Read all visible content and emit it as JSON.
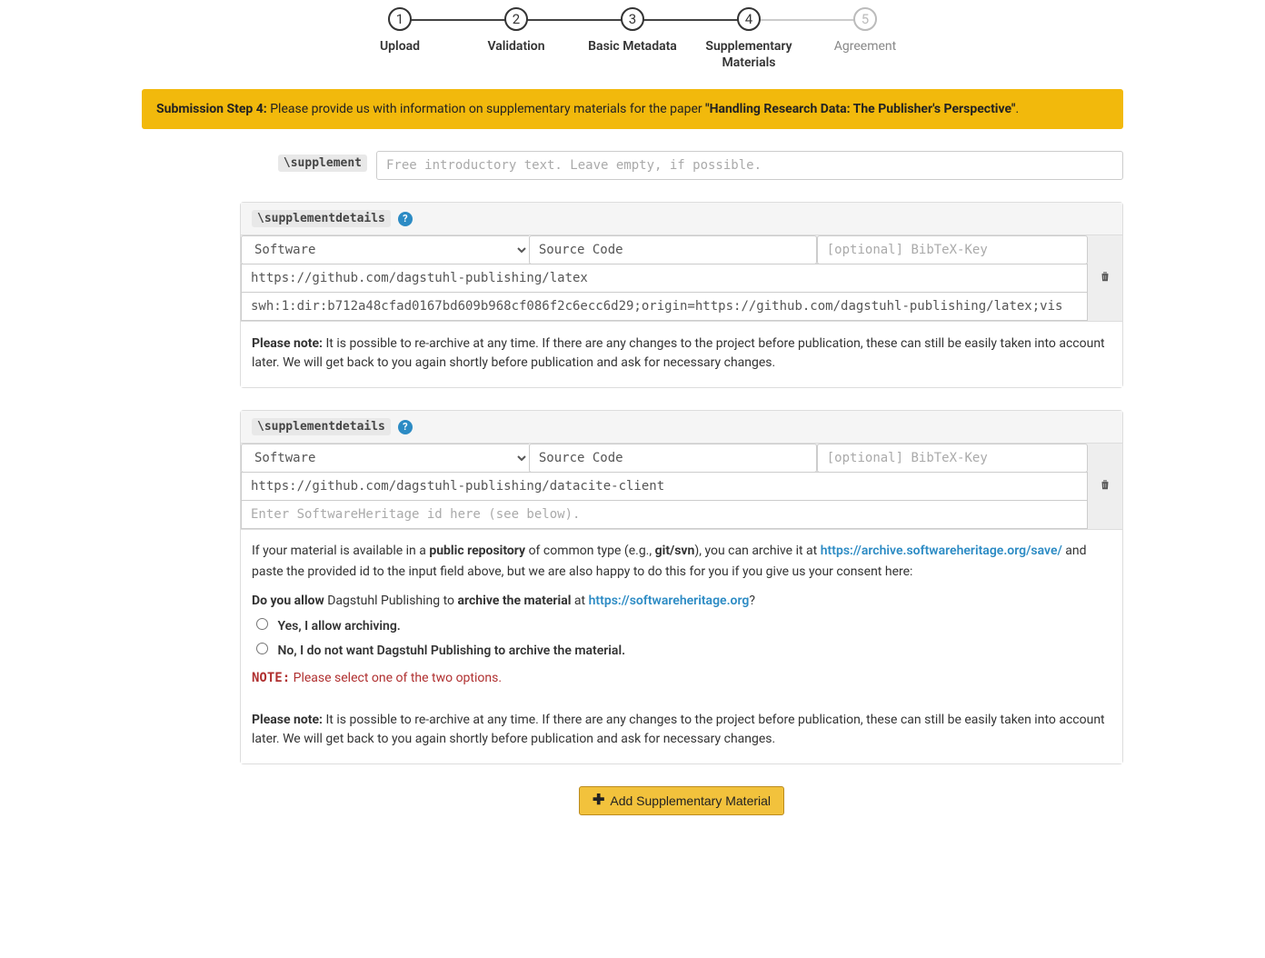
{
  "stepper": {
    "steps": [
      {
        "num": "1",
        "label": "Upload"
      },
      {
        "num": "2",
        "label": "Validation"
      },
      {
        "num": "3",
        "label": "Basic Metadata"
      },
      {
        "num": "4",
        "label": "Supplementary Materials"
      },
      {
        "num": "5",
        "label": "Agreement"
      }
    ]
  },
  "alert": {
    "prefix": "Submission Step 4:",
    "text": " Please provide us with information on supplementary materials for the paper ",
    "paper_title": "\"Handling Research Data: The Publisher's Perspective\"",
    "suffix": "."
  },
  "supplement_label": "\\supplement",
  "supplement_placeholder": "Free introductory text. Leave empty, if possible.",
  "details_label": "\\supplementdetails",
  "type_option": "Software",
  "subtype_value": "Source Code",
  "bibkey_placeholder": "[optional] BibTeX-Key",
  "swh_placeholder": "Enter SoftwareHeritage id here (see below).",
  "block1": {
    "url": "https://github.com/dagstuhl-publishing/latex",
    "swh": "swh:1:dir:b712a48cfad0167bd609b968cf086f2c6ecc6d29;origin=https://github.com/dagstuhl-publishing/latex;vis"
  },
  "block2": {
    "url": "https://github.com/dagstuhl-publishing/datacite-client",
    "swh": ""
  },
  "note": {
    "label": "Please note:",
    "text": " It is possible to re-archive at any time. If there are any changes to the project before publication, these can still be easily taken into account later. We will get back to you again shortly before publication and ask for necessary changes."
  },
  "consent": {
    "intro_a": "If your material is available in a ",
    "intro_b": "public repository",
    "intro_c": " of common type (e.g., ",
    "intro_d": "git/svn",
    "intro_e": "), you can archive it at ",
    "archive_url": "https://archive.softwareheritage.org/save/",
    "intro_f": " and paste the provided id to the input field above, but we are also happy to do this for you if you give us your consent here:",
    "q_a": "Do you allow",
    "q_b": " Dagstuhl Publishing to ",
    "q_c": "archive the material",
    "q_d": " at ",
    "swh_url": "https://softwareheritage.org",
    "q_e": "?",
    "opt_yes": "Yes, I allow archiving.",
    "opt_no": "No, I do not want Dagstuhl Publishing to archive the material.",
    "err_label": "NOTE:",
    "err_text": "  Please select one of the two options."
  },
  "add_button": "Add Supplementary Material"
}
